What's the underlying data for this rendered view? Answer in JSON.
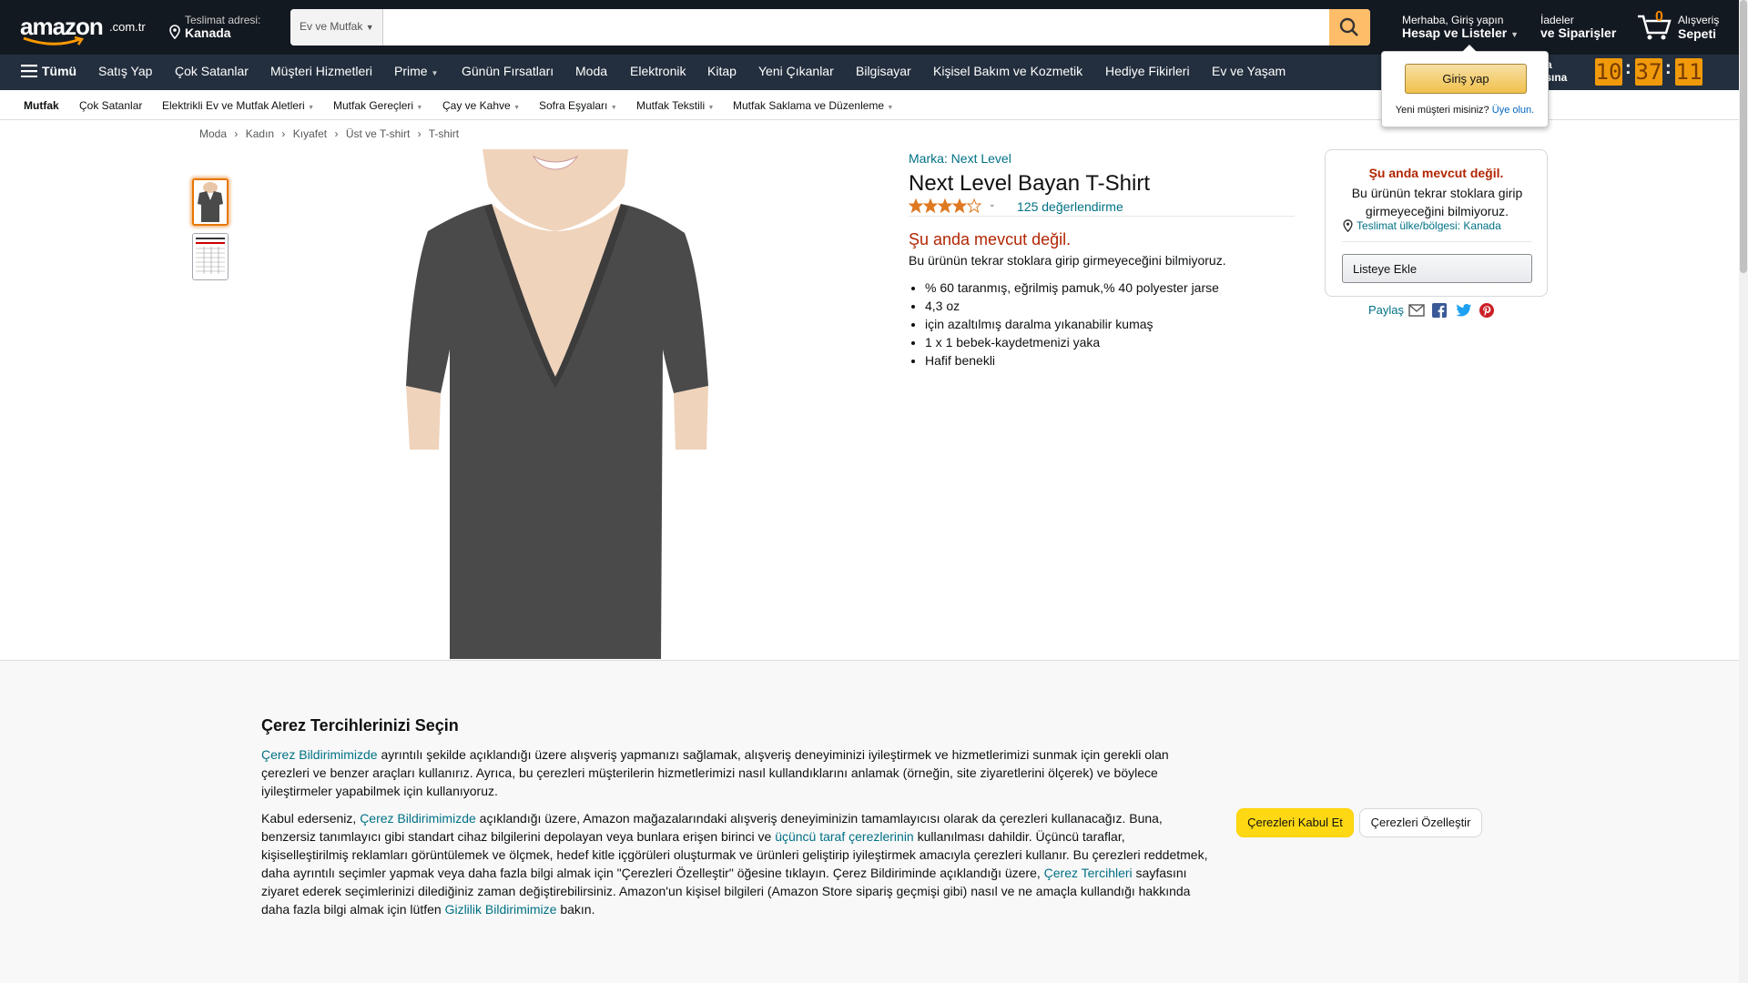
{
  "header": {
    "logo_text": "amazon",
    "logo_suffix": ".com.tr",
    "delivery_label": "Teslimat adresi:",
    "delivery_value": "Kanada",
    "search_category": "Ev ve Mutfak",
    "search_value": "",
    "account_greeting": "Merhaba, Giriş yapın",
    "account_label": "Hesap ve Listeler",
    "orders_line1": "İadeler",
    "orders_line2": "ve Siparişler",
    "cart_count": "0",
    "cart_line1": "Alışveriş",
    "cart_line2": "Sepeti"
  },
  "signin_popup": {
    "button": "Giriş yap",
    "new_customer": "Yeni müşteri misiniz?",
    "signup": "Üye olun."
  },
  "nav": {
    "all": "Tümü",
    "items": [
      "Satış Yap",
      "Çok Satanlar",
      "Müşteri Hizmetleri",
      "Prime",
      "Günün Fırsatları",
      "Moda",
      "Elektronik",
      "Kitap",
      "Yeni Çıkanlar",
      "Bilgisayar",
      "Kişisel Bakım ve Kozmetik",
      "Hediye Fikirleri",
      "Ev ve Yaşam"
    ],
    "deal_line1": "uma",
    "deal_line2": "masına",
    "countdown": [
      "10",
      "37",
      "11"
    ]
  },
  "subnav": {
    "items": [
      "Mutfak",
      "Çok Satanlar",
      "Elektrikli Ev ve Mutfak Aletleri",
      "Mutfak Gereçleri",
      "Çay ve Kahve",
      "Sofra Eşyaları",
      "Mutfak Tekstili",
      "Mutfak Saklama ve Düzenleme"
    ]
  },
  "breadcrumb": [
    "Moda",
    "Kadın",
    "Kıyafet",
    "Üst ve T-shirt",
    "T-shirt"
  ],
  "product": {
    "brand": "Marka: Next Level",
    "title": "Next Level Bayan T-Shirt",
    "rating": 4.0,
    "ratings_count": "125 değerlendirme",
    "availability": "Şu anda mevcut değil.",
    "availability_note": "Bu ürünün tekrar stoklara girip girmeyeceğini bilmiyoruz.",
    "bullets": [
      "% 60 taranmış, eğrilmiş pamuk,% 40 polyester jarse",
      "4,3 oz",
      "için azaltılmış daralma yıkanabilir kumaş",
      "1 x 1 bebek-kaydetmenizi yaka",
      "Hafif benekli"
    ]
  },
  "buybox": {
    "status": "Şu anda mevcut değil.",
    "note": "Bu ürünün tekrar stoklara girip girmeyeceğini bilmiyoruz.",
    "delivery": "Teslimat ülke/bölgesi: Kanada",
    "add_to_list": "Listeye Ekle"
  },
  "share": {
    "label": "Paylaş"
  },
  "colors": {
    "header": "#131921",
    "nav": "#232f3e",
    "search_btn": "#febd69",
    "link": "#007185",
    "alert": "#b12704",
    "accept": "#ffd814"
  },
  "cookie": {
    "title": "Çerez Tercihlerinizi Seçin",
    "p1_link": "Çerez Bildirimimizde",
    "p1": " ayrıntılı şekilde açıklandığı üzere alışveriş yapmanızı sağlamak, alışveriş deneyiminizi iyileştirmek ve hizmetlerimizi sunmak için gerekli olan çerezleri ve benzer araçları kullanırız. Ayrıca, bu çerezleri müşterilerin hizmetlerimizi nasıl kullandıklarını anlamak (örneğin, site ziyaretlerini ölçerek) ve böylece iyileştirmeler yapabilmek için kullanıyoruz.",
    "p2_a": "Kabul ederseniz, ",
    "p2_link1": "Çerez Bildirimimizde",
    "p2_b": " açıklandığı üzere, Amazon mağazalarındaki alışveriş deneyiminizin tamamlayıcısı olarak da çerezleri kullanacağız. Buna, benzersiz tanımlayıcı gibi standart cihaz bilgilerini depolayan veya bunlara erişen birinci ve ",
    "p2_link2": "üçüncü taraf çerezlerinin",
    "p2_c": " kullanılması dahildir. Üçüncü taraflar, kişiselleştirilmiş reklamları görüntülemek ve ölçmek, hedef kitle içgörüleri oluşturmak ve ürünleri geliştirip iyileştirmek amacıyla çerezleri kullanır. Bu çerezleri reddetmek, daha ayrıntılı seçimler yapmak veya daha fazla bilgi almak için \"Çerezleri Özelleştir\" öğesine tıklayın. Çerez Bildiriminde açıklandığı üzere, ",
    "p2_link3": "Çerez Tercihleri",
    "p2_d": " sayfasını ziyaret ederek seçimlerinizi dilediğiniz zaman değiştirebilirsiniz. Amazon'un kişisel bilgileri (Amazon Store sipariş geçmişi gibi) nasıl ve ne amaçla kullandığı hakkında daha fazla bilgi almak için lütfen ",
    "p2_link4": "Gizlilik Bildirimimize",
    "p2_e": " bakın.",
    "accept": "Çerezleri Kabul Et",
    "customize": "Çerezleri Özelleştir"
  }
}
